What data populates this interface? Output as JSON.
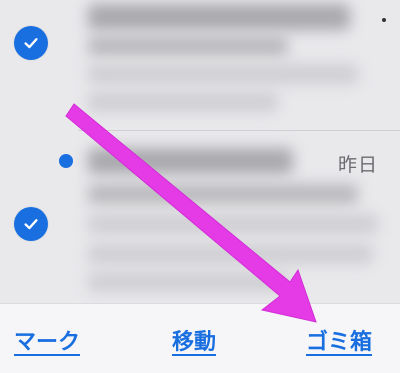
{
  "messages": [
    {
      "selected": true,
      "unread": false,
      "date": "",
      "content_obscured": true
    },
    {
      "selected": true,
      "unread": true,
      "date": "昨日",
      "content_obscured": true
    }
  ],
  "toolbar": {
    "mark_label": "マーク",
    "move_label": "移動",
    "trash_label": "ゴミ箱"
  },
  "colors": {
    "accent": "#1a6fe0",
    "annotation_arrow": "#e43be6",
    "background": "#e9e9ec",
    "toolbar_background": "#f6f6f8"
  },
  "icons": {
    "selected_indicator": "checkmark-circle-icon",
    "unread_indicator": "unread-dot-icon",
    "annotation": "arrow-annotation-icon"
  }
}
